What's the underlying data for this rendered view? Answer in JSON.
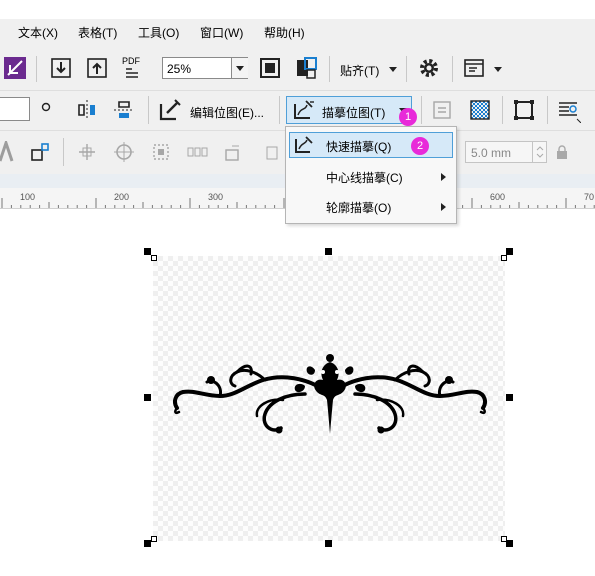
{
  "menubar": {
    "items": [
      {
        "label": "文本(X)"
      },
      {
        "label": "表格(T)"
      },
      {
        "label": "工具(O)"
      },
      {
        "label": "窗口(W)"
      },
      {
        "label": "帮助(H)"
      }
    ]
  },
  "toolbar1": {
    "pdf_label": "PDF",
    "zoom_value": "25%",
    "snap_label": "贴齐(T)"
  },
  "toolbar2": {
    "edit_bitmap_label": "编辑位图(E)...",
    "trace_bitmap_label": "描摹位图(T)",
    "badge1": "1"
  },
  "toolbar3": {
    "size_value": "5.0 mm"
  },
  "popup": {
    "items": [
      {
        "label": "快速描摹(Q)",
        "badge": "2",
        "highlighted": true
      },
      {
        "label": "中心线描摹(C)",
        "has_submenu": true
      },
      {
        "label": "轮廓描摹(O)",
        "has_submenu": true
      }
    ]
  },
  "ruler": {
    "ticks": [
      "100",
      "200",
      "300",
      "600",
      "70"
    ]
  },
  "colors": {
    "accent": "#e829d9",
    "highlight": "#d6e9f8",
    "highlight_border": "#4f9fd8"
  }
}
